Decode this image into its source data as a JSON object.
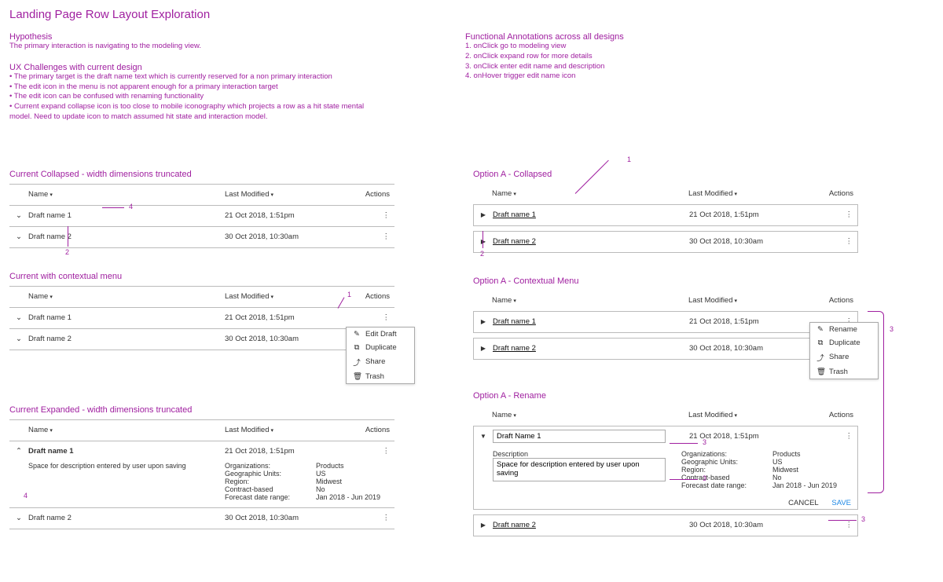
{
  "title": "Landing Page Row Layout Exploration",
  "hypothesis": {
    "heading": "Hypothesis",
    "text": "The primary interaction is navigating to the modeling view."
  },
  "challenges": {
    "heading": "UX Challenges with current design",
    "b1": "• The primary target is the draft name text which is currently reserved for a non primary interaction",
    "b2": "• The edit icon in the menu is not apparent enough for a primary interaction target",
    "b3": "• The edit icon can be confused with renaming functionality",
    "b4": "• Current expand collapse icon is too close to mobile iconography which projects a row as a hit state mental model.  Need to update icon to match assumed hit state and interaction model."
  },
  "annotations": {
    "heading": "Functional Annotations across all designs",
    "a1": "1. onClick go to modeling view",
    "a2": "2. onClick expand row for more details",
    "a3": "3. onClick enter edit name and description",
    "a4": "4. onHover trigger edit name icon"
  },
  "cols": {
    "name": "Name",
    "modified": "Last Modified",
    "actions": "Actions"
  },
  "rows": {
    "d1": {
      "name": "Draft name 1",
      "mod": "21 Oct 2018, 1:51pm"
    },
    "d2": {
      "name": "Draft name 2",
      "mod": "30 Oct 2018, 10:30am"
    }
  },
  "menu_current": {
    "m1": "Edit Draft",
    "m2": "Duplicate",
    "m3": "Share",
    "m4": "Trash"
  },
  "menu_a": {
    "m1": "Rename",
    "m2": "Duplicate",
    "m3": "Share",
    "m4": "Trash"
  },
  "expanded": {
    "desc": "Space for description entered by user upon saving",
    "k1": "Organizations:",
    "v1": "Products",
    "k2": "Geographic Units:",
    "v2": "US",
    "k3": "Region:",
    "v3": "Midwest",
    "k4": "Contract-based",
    "v4": "No",
    "k5": "Forecast date range:",
    "v5": "Jan 2018 - Jun 2019"
  },
  "rename": {
    "name_value": "Draft Name 1",
    "desc_label": "Description",
    "desc_value": "Space for description entered by user upon saving",
    "cancel": "CANCEL",
    "save": "SAVE"
  },
  "sections": {
    "s1": "Current Collapsed - width dimensions truncated",
    "s2": "Current with contextual menu",
    "s3": "Current Expanded - width dimensions truncated",
    "s4": "Option A - Collapsed",
    "s5": "Option A - Contextual Menu",
    "s6": "Option A - Rename"
  },
  "nums": {
    "n1": "1",
    "n2": "2",
    "n3": "3",
    "n4": "4"
  }
}
